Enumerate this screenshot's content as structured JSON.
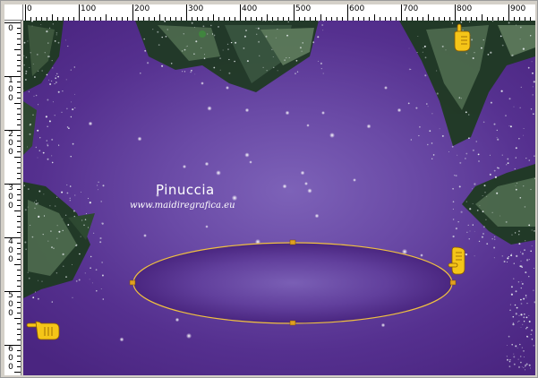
{
  "ruler": {
    "top_labels": [
      "0",
      "100",
      "200",
      "300",
      "400",
      "500",
      "600",
      "700",
      "800",
      "900"
    ],
    "left_labels": [
      "0",
      "100",
      "200",
      "300",
      "400",
      "500",
      "600"
    ]
  },
  "canvas": {
    "watermark_title": "Pinuccia",
    "watermark_url": "www.maidiregrafica.eu",
    "background_color": "#6a4aa6",
    "selection_color": "#e0a020"
  },
  "icons": [
    "pointing-hand-up-icon",
    "pointing-hand-left-icon",
    "pointing-hand-right-icon"
  ]
}
